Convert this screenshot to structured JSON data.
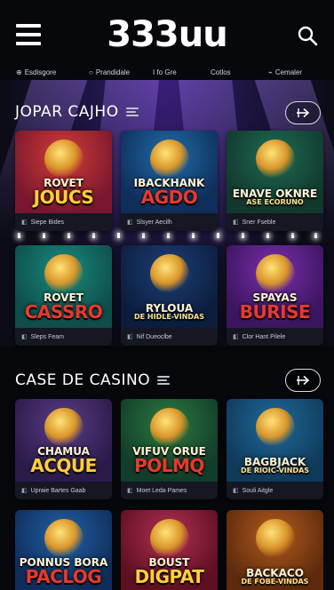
{
  "header": {
    "logo": "333uu",
    "menu_icon": "hamburger-menu-icon",
    "search_icon": "search-icon"
  },
  "categories": [
    {
      "label": "Esdisgore",
      "icon": "compass-icon"
    },
    {
      "label": "Prandidale",
      "icon": "circle-icon"
    },
    {
      "label": "I fo Gre",
      "icon": "none"
    },
    {
      "label": "Cotlos",
      "icon": "none"
    },
    {
      "label": "Cemaler",
      "icon": "tag-icon"
    }
  ],
  "sections": [
    {
      "title": "JOPAR CAJHO",
      "cards": [
        {
          "t1": "ROVET",
          "t2": "JOUCS",
          "t3": "",
          "meta": "Siepe Bides",
          "colors": [
            "#7a1730",
            "#d23d35"
          ]
        },
        {
          "t1": "IBACKHANK",
          "t2": "AGDO",
          "t3": "",
          "meta": "Slsyer Aecilh",
          "colors": [
            "#0f2e5c",
            "#1f6ea8"
          ]
        },
        {
          "t1": "ENAVE OKNRE",
          "t2": "",
          "t3": "ASE ECORUNO",
          "meta": "Sner Fseble",
          "colors": [
            "#12382e",
            "#1e6b53"
          ]
        },
        {
          "t1": "ROVET",
          "t2": "CASSRO",
          "t3": "",
          "meta": "Sleps Feam",
          "colors": [
            "#0e4d4a",
            "#1a8a7d"
          ]
        },
        {
          "t1": "RYLOUA",
          "t2": "",
          "t3": "DE HIDLE-VINDAS",
          "meta": "Nif Dueoclbe",
          "colors": [
            "#0c1d3d",
            "#1c3f78"
          ]
        },
        {
          "t1": "SPAYAS",
          "t2": "BURISE",
          "t3": "",
          "meta": "Clor Hant Pilele",
          "colors": [
            "#3b155e",
            "#7a2fae"
          ]
        }
      ]
    },
    {
      "title": "CASE DE CASINO",
      "cards": [
        {
          "t1": "CHAMUA",
          "t2": "ACQUE",
          "t3": "",
          "meta": "Upraie Bartes Gaab",
          "colors": [
            "#2b1b4a",
            "#5a3c85"
          ]
        },
        {
          "t1": "VIFUV ORUE",
          "t2": "POLMQ",
          "t3": "",
          "meta": "Moet Leda Pames",
          "colors": [
            "#123d2a",
            "#2c7a3f"
          ]
        },
        {
          "t1": "BAGBJACK",
          "t2": "",
          "t3": "DE RIOIC-VINDAS",
          "meta": "Souli Aitgle",
          "colors": [
            "#103a5a",
            "#1f6a9a"
          ]
        },
        {
          "t1": "PONNUS BORA",
          "t2": "PACLOG",
          "t3": "",
          "meta": "",
          "colors": [
            "#0f2d5a",
            "#2160a6"
          ]
        },
        {
          "t1": "BOUST",
          "t2": "DIGPAT",
          "t3": "",
          "meta": "",
          "colors": [
            "#5e0f22",
            "#b23052"
          ]
        },
        {
          "t1": "BACKACO",
          "t2": "",
          "t3": "DE FOBE-VINDAS",
          "meta": "",
          "colors": [
            "#5c2a0d",
            "#b35a1c"
          ]
        }
      ]
    }
  ]
}
